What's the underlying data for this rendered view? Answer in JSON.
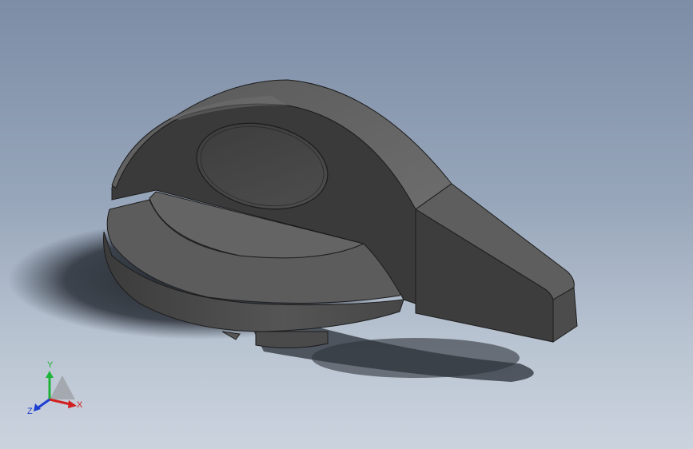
{
  "viewport": {
    "background_top": "#7d8da6",
    "background_bottom": "#cbd3de"
  },
  "model": {
    "part": "knob",
    "body_color": "#4a4a4a",
    "edge_color": "#1c1c1c"
  },
  "triad": {
    "x_label": "X",
    "y_label": "Y",
    "z_label": "Z",
    "x_color": "#d21f1f",
    "y_color": "#1fb33a",
    "z_color": "#1f3fd2"
  }
}
